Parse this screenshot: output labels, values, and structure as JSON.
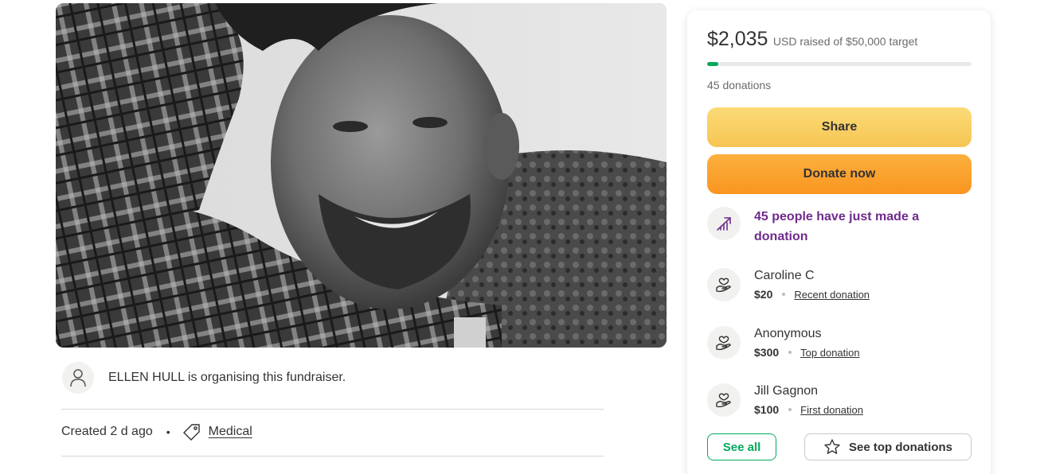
{
  "hero": {
    "image_description_icon": "fundraiser-photo"
  },
  "organiser": {
    "text": "ELLEN HULL is organising this fundraiser.",
    "avatar_icon": "user-icon"
  },
  "meta": {
    "created": "Created 2 d ago",
    "separator": "•",
    "category": "Medical",
    "category_icon": "tag-icon"
  },
  "donation_card": {
    "raised_amount": "$2,035",
    "raised_suffix": "USD raised of $50,000 target",
    "progress_fraction": 0.0407,
    "progress_color": "#02a95c",
    "donation_count": "45 donations",
    "share_label": "Share",
    "donate_label": "Donate now",
    "activity": {
      "icon": "trending-up-icon",
      "text": "45 people have just made a donation",
      "color": "#6f2b8d"
    },
    "donors": [
      {
        "name": "Caroline C",
        "amount": "$20",
        "kind": "Recent donation",
        "icon": "hand-heart-icon"
      },
      {
        "name": "Anonymous",
        "amount": "$300",
        "kind": "Top donation",
        "icon": "hand-heart-icon"
      },
      {
        "name": "Jill Gagnon",
        "amount": "$100",
        "kind": "First donation",
        "icon": "hand-heart-icon"
      }
    ],
    "see_all_label": "See all",
    "see_top_label": "See top donations",
    "accent_color": "#02a95c",
    "share_color": "#f6c553",
    "donate_color": "#f99520"
  }
}
